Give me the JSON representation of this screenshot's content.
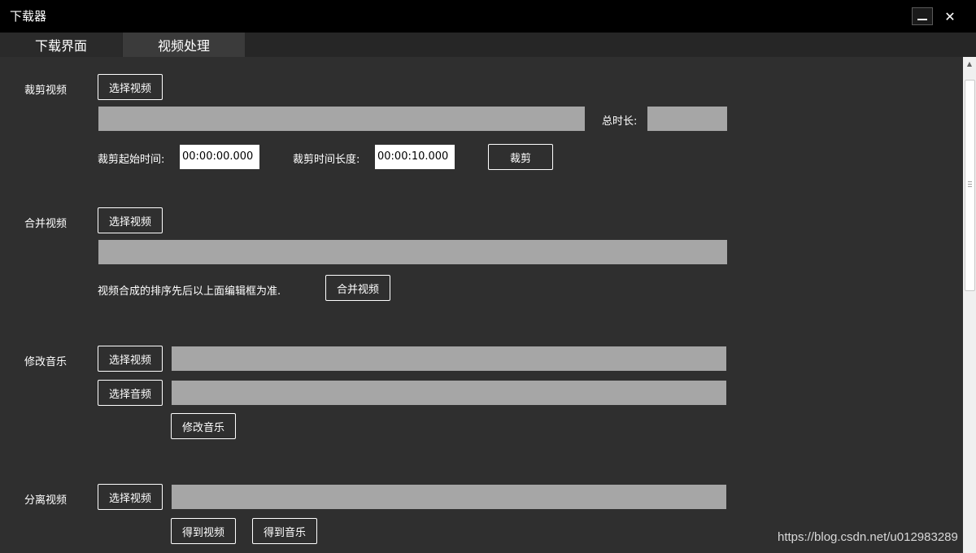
{
  "window": {
    "title": "下载器",
    "close_glyph": "✕"
  },
  "tabs": [
    {
      "label": "下载界面"
    },
    {
      "label": "视频处理"
    }
  ],
  "crop": {
    "label": "裁剪视频",
    "select_button": "选择视频",
    "path_value": "",
    "duration_label": "总时长:",
    "duration_value": "",
    "start_label": "裁剪起始时间:",
    "start_value": "00:00:00.000",
    "length_label": "裁剪时间长度:",
    "length_value": "00:00:10.000",
    "crop_button": "裁剪"
  },
  "merge": {
    "label": "合并视频",
    "select_button": "选择视频",
    "paths_value": "",
    "note": "视频合成的排序先后以上面编辑框为准.",
    "merge_button": "合并视频"
  },
  "music": {
    "label": "修改音乐",
    "select_video_button": "选择视频",
    "video_path_value": "",
    "select_audio_button": "选择音频",
    "audio_path_value": "",
    "apply_button": "修改音乐"
  },
  "separate": {
    "label": "分离视频",
    "select_button": "选择视频",
    "path_value": "",
    "get_video_button": "得到视频",
    "get_music_button": "得到音乐"
  },
  "watermark": "https://blog.csdn.net/u012983289",
  "colors": {
    "titlebar": "#000000",
    "background": "#2f2f2f",
    "field": "#a6a6a6",
    "active_tab": "#3b3b3b"
  }
}
